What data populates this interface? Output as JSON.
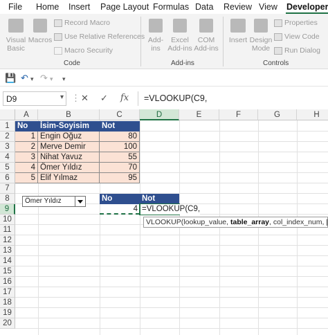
{
  "ribbon_tabs": [
    "File",
    "Home",
    "Insert",
    "Page Layout",
    "Formulas",
    "Data",
    "Review",
    "View",
    "Developer"
  ],
  "ribbon": {
    "visual_basic": [
      "Visual",
      "Basic"
    ],
    "macros": "Macros",
    "record_macro": "Record Macro",
    "use_relative_refs": "Use Relative References",
    "macro_security": "Macro Security",
    "code_group": "Code",
    "add_ins": [
      "Add-",
      "ins"
    ],
    "excel_add_ins": [
      "Excel",
      "Add-ins"
    ],
    "com_add_ins": [
      "COM",
      "Add-ins"
    ],
    "addins_group": "Add-ins",
    "insert": "Insert",
    "design_mode": [
      "Design",
      "Mode"
    ],
    "properties": "Properties",
    "view_code": "View Code",
    "run_dialog": "Run Dialog",
    "controls_group": "Controls"
  },
  "quick_access": {
    "save_icon": "save-icon",
    "undo_icon": "undo-icon",
    "redo_icon": "redo-icon"
  },
  "formula_bar": {
    "name_box": "D9",
    "cancel": "✕",
    "enter": "✓",
    "fx": "fx",
    "formula": "=VLOOKUP(C9,"
  },
  "columns": [
    "A",
    "B",
    "C",
    "D",
    "E",
    "F",
    "G",
    "H"
  ],
  "rows": [
    "1",
    "2",
    "3",
    "4",
    "5",
    "6",
    "7",
    "8",
    "9",
    "10",
    "11",
    "12",
    "13",
    "14",
    "15",
    "16",
    "17",
    "18",
    "19",
    "20"
  ],
  "table": {
    "headers": [
      "No",
      "İsim-Soyisim",
      "Not"
    ],
    "rows": [
      [
        "1",
        "Engin Oğuz",
        "80"
      ],
      [
        "2",
        "Merve Demir",
        "100"
      ],
      [
        "3",
        "Nihat Yavuz",
        "55"
      ],
      [
        "4",
        "Ömer Yıldız",
        "70"
      ],
      [
        "5",
        "Elif Yılmaz",
        "95"
      ]
    ]
  },
  "dropdown": {
    "value": "Ömer Yıldız"
  },
  "lookup": {
    "headers": [
      "No",
      "Not"
    ],
    "no_value": "4",
    "editing_text": "=VLOOKUP(C9,"
  },
  "tooltip": {
    "fn": "VLOOKUP(",
    "arg1": "lookup_value, ",
    "arg2": "table_array",
    "rest": ", col_index_num, [range_lookup])"
  },
  "colors": {
    "header_fill": "#2f4f8f",
    "row_fill": "#fbe2d5",
    "selection": "#217346"
  }
}
